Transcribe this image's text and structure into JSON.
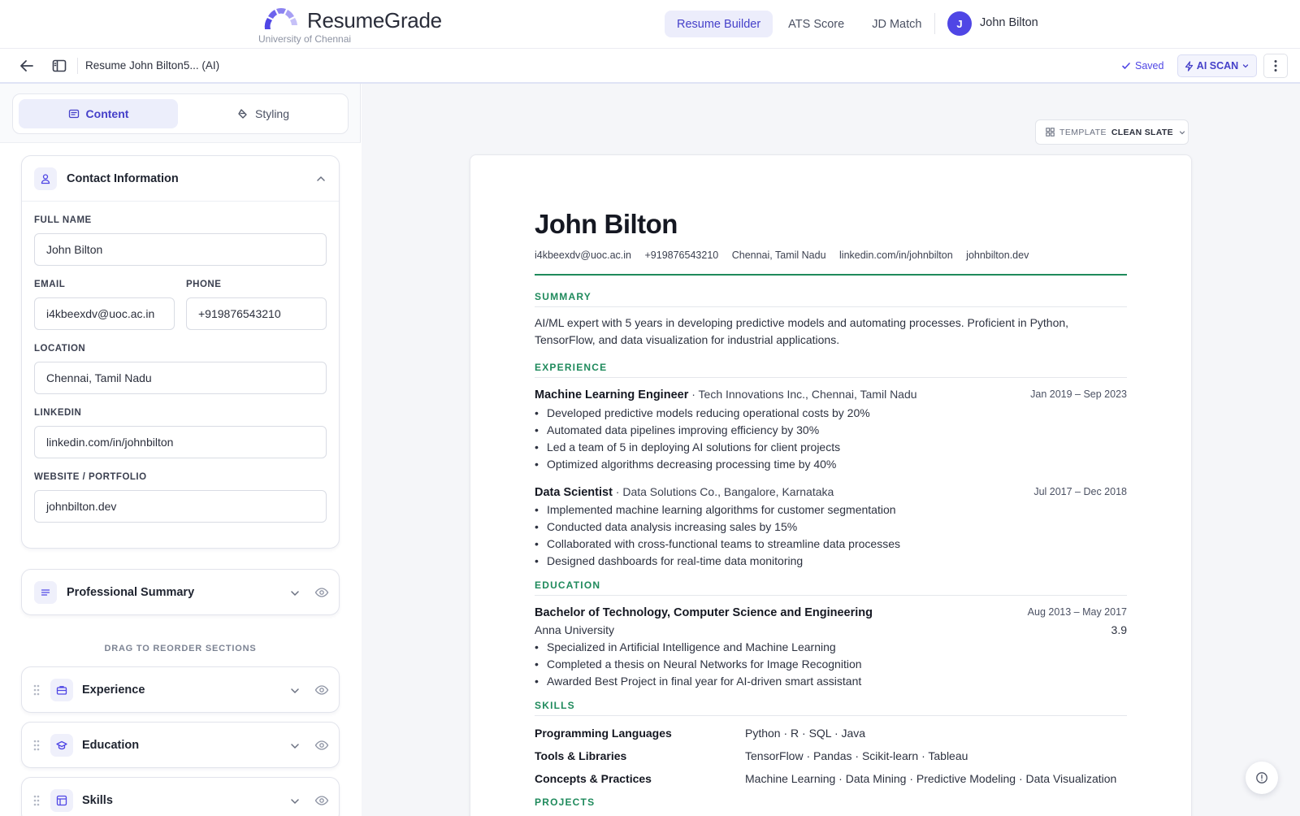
{
  "brand": {
    "name_bold": "Resume",
    "name_rest": "Grade",
    "subtitle": "University of Chennai"
  },
  "nav": {
    "tabs": [
      "Resume Builder",
      "ATS Score",
      "JD Match"
    ],
    "active_tab": "Resume Builder",
    "user": {
      "initial": "J",
      "name": "John Bilton"
    }
  },
  "toolbar": {
    "doc_title": "Resume John Bilton5... (AI)",
    "saved_label": "Saved",
    "scan_label": "AI SCAN"
  },
  "editor": {
    "mode_tabs": {
      "content": "Content",
      "styling": "Styling"
    },
    "contact": {
      "title": "Contact Information",
      "full_name_label": "FULL NAME",
      "full_name": "John Bilton",
      "email_label": "EMAIL",
      "email": "i4kbeexdv@uoc.ac.in",
      "phone_label": "PHONE",
      "phone": "+919876543210",
      "location_label": "LOCATION",
      "location": "Chennai, Tamil Nadu",
      "linkedin_label": "LINKEDIN",
      "linkedin": "linkedin.com/in/johnbilton",
      "website_label": "WEBSITE / PORTFOLIO",
      "website": "johnbilton.dev"
    },
    "summary_title": "Professional Summary",
    "drag_hint": "DRAG TO REORDER SECTIONS",
    "sections": [
      "Experience",
      "Education",
      "Skills"
    ]
  },
  "preview": {
    "template_label": "TEMPLATE",
    "template_name": "CLEAN SLATE",
    "name": "John Bilton",
    "contacts": [
      "i4kbeexdv@uoc.ac.in",
      "+919876543210",
      "Chennai, Tamil Nadu",
      "linkedin.com/in/johnbilton",
      "johnbilton.dev"
    ],
    "headings": {
      "summary": "SUMMARY",
      "experience": "EXPERIENCE",
      "education": "EDUCATION",
      "skills": "SKILLS",
      "projects": "PROJECTS"
    },
    "summary": "AI/ML expert with 5 years in developing predictive models and automating processes. Proficient in Python, TensorFlow, and data visualization for industrial applications.",
    "experience": [
      {
        "role": "Machine Learning Engineer",
        "company": "· Tech Innovations Inc., Chennai, Tamil Nadu",
        "dates": "Jan 2019 – Sep 2023",
        "bullets": [
          "Developed predictive models reducing operational costs by 20%",
          "Automated data pipelines improving efficiency by 30%",
          "Led a team of 5 in deploying AI solutions for client projects",
          "Optimized algorithms decreasing processing time by 40%"
        ]
      },
      {
        "role": "Data Scientist",
        "company": "· Data Solutions Co., Bangalore, Karnataka",
        "dates": "Jul 2017 – Dec 2018",
        "bullets": [
          "Implemented machine learning algorithms for customer segmentation",
          "Conducted data analysis increasing sales by 15%",
          "Collaborated with cross-functional teams to streamline data processes",
          "Designed dashboards for real-time data monitoring"
        ]
      }
    ],
    "education": {
      "degree": "Bachelor of Technology, Computer Science and Engineering",
      "dates": "Aug 2013 – May 2017",
      "school": "Anna University",
      "gpa": "3.9",
      "bullets": [
        "Specialized in Artificial Intelligence and Machine Learning",
        "Completed a thesis on Neural Networks for Image Recognition",
        "Awarded Best Project in final year for AI-driven smart assistant"
      ]
    },
    "skills": [
      {
        "k": "Programming Languages",
        "v": "Python · R · SQL · Java"
      },
      {
        "k": "Tools & Libraries",
        "v": "TensorFlow · Pandas · Scikit-learn · Tableau"
      },
      {
        "k": "Concepts & Practices",
        "v": "Machine Learning · Data Mining · Predictive Modeling · Data Visualization"
      }
    ]
  },
  "colors": {
    "accent": "#4f46e5",
    "section_green": "#1f8a5c"
  }
}
